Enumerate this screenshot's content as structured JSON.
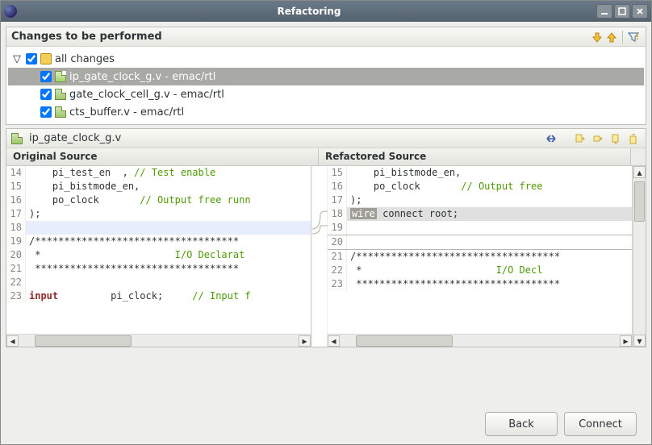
{
  "window": {
    "title": "Refactoring"
  },
  "changes": {
    "header": "Changes to be performed",
    "root_label": "all changes",
    "items": [
      {
        "file": "ip_gate_clock_g.v",
        "loc": "emac/rtl",
        "selected": true
      },
      {
        "file": "gate_clock_cell_g.v",
        "loc": "emac/rtl",
        "selected": false
      },
      {
        "file": "cts_buffer.v",
        "loc": "emac/rtl",
        "selected": false
      }
    ]
  },
  "diff": {
    "filename": "ip_gate_clock_g.v",
    "left_header": "Original Source",
    "right_header": "Refactored Source",
    "left_lines": [
      {
        "n": "14",
        "text": "    pi_test_en  , ",
        "cmt": "// Test enable"
      },
      {
        "n": "15",
        "text": "    pi_bistmode_en,"
      },
      {
        "n": "16",
        "text": "    po_clock       ",
        "cmt": "// Output free runn"
      },
      {
        "n": "17",
        "text": ");"
      },
      {
        "n": "18",
        "text": " ",
        "hl": true
      },
      {
        "n": "19",
        "text": "/***********************************"
      },
      {
        "n": "20",
        "text": " *                       ",
        "cmt": "I/O Declarat"
      },
      {
        "n": "21",
        "text": " ***********************************"
      },
      {
        "n": "22",
        "text": " "
      },
      {
        "n": "23",
        "kw": "input",
        "text2": "         pi_clock;     ",
        "cmt": "// Input f"
      }
    ],
    "right_lines": [
      {
        "n": "15",
        "text": "    pi_bistmode_en,"
      },
      {
        "n": "16",
        "text": "    po_clock       ",
        "cmt": "// Output free "
      },
      {
        "n": "17",
        "text": ");"
      },
      {
        "n": "18",
        "wire": "wire",
        "after": " connect root;",
        "ins": true
      },
      {
        "n": "19",
        "text": " "
      },
      {
        "n": "20",
        "text": " ",
        "divline": true
      },
      {
        "n": "21",
        "text": "/***********************************"
      },
      {
        "n": "22",
        "text": " *                       ",
        "cmt": "I/O Decl"
      },
      {
        "n": "23",
        "text": " ***********************************"
      }
    ]
  },
  "buttons": {
    "back": "Back",
    "connect": "Connect"
  }
}
